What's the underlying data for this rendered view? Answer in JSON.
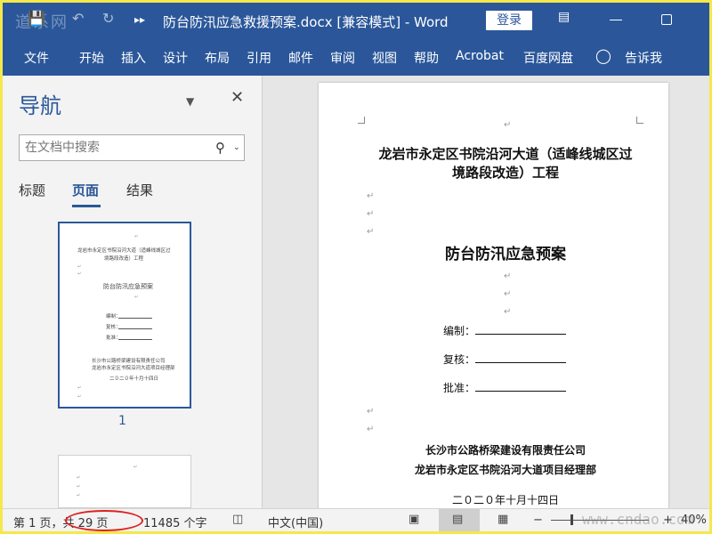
{
  "titlebar": {
    "watermark": "道系网",
    "doc_title": "防台防汛应急救援预案.docx [兼容模式]  -  Word",
    "login_label": "登录"
  },
  "ribbon": {
    "tabs": [
      "文件",
      "开始",
      "插入",
      "设计",
      "布局",
      "引用",
      "邮件",
      "审阅",
      "视图",
      "帮助",
      "Acrobat",
      "百度网盘"
    ],
    "tell_me": "告诉我"
  },
  "nav": {
    "title": "导航",
    "search_placeholder": "在文档中搜索",
    "tabs": [
      "标题",
      "页面",
      "结果"
    ],
    "active_tab": "页面",
    "thumb_page_label": "1"
  },
  "thumbnail": {
    "line1": "龙岩市永定区书院沿河大道（适峰线城区过",
    "line2": "境路段改造）工程",
    "plan": "防台防汛应急预案",
    "f1": "编制：",
    "f2": "复核：",
    "f3": "批准：",
    "c1": "长沙市公路桥梁建设有限责任公司",
    "c2": "龙岩市永定区书院沿河大道项目经理部",
    "date": "二０二０年十月十四日"
  },
  "document": {
    "paragraph_mark": "↵",
    "project_title_line1": "龙岩市永定区书院沿河大道（适峰线城区过",
    "project_title_line2": "境路段改造）工程",
    "plan_title": "防台防汛应急预案",
    "fields": [
      "编制：",
      "复核：",
      "批准："
    ],
    "company1": "长沙市公路桥梁建设有限责任公司",
    "company2": "龙岩市永定区书院沿河大道项目经理部",
    "date": "二０二０年十月十四日"
  },
  "status": {
    "page": "第 1 页，共 29 页",
    "words": "11485 个字",
    "language": "中文(中国)",
    "zoom_minus": "−",
    "zoom_plus": "+",
    "zoom": "40%",
    "zoom_level_percent": 40
  },
  "watermark_br": "www.cndao.com"
}
